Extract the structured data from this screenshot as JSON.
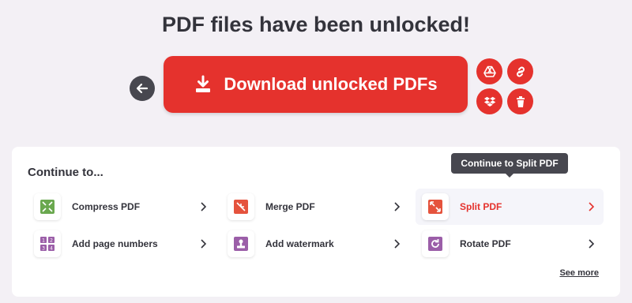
{
  "header": {
    "title": "PDF files have been unlocked!"
  },
  "actions": {
    "download_label": "Download unlocked PDFs",
    "back": "arrow-left-icon",
    "google_drive": "google-drive-icon",
    "copy_link": "link-icon",
    "dropbox": "dropbox-icon",
    "delete": "trash-icon"
  },
  "continue": {
    "title": "Continue to...",
    "tools": [
      {
        "label": "Compress PDF",
        "icon": "compress-icon",
        "color": "#6aa84f"
      },
      {
        "label": "Merge PDF",
        "icon": "merge-icon",
        "color": "#e5533d"
      },
      {
        "label": "Split PDF",
        "icon": "split-icon",
        "color": "#e5533d"
      },
      {
        "label": "Add page numbers",
        "icon": "page-numbers-icon",
        "color": "#9b5ea8"
      },
      {
        "label": "Add watermark",
        "icon": "watermark-icon",
        "color": "#9b5ea8"
      },
      {
        "label": "Rotate PDF",
        "icon": "rotate-icon",
        "color": "#9b5ea8"
      }
    ],
    "see_more": "See more"
  },
  "tooltip": {
    "text": "Continue to Split PDF"
  },
  "colors": {
    "accent": "#e5322d",
    "dark": "#47474f",
    "background": "#f3f0f5"
  }
}
